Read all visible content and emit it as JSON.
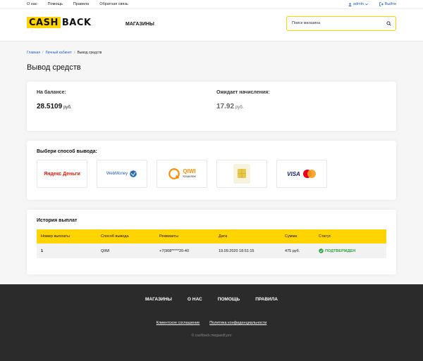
{
  "topbar": {
    "links": [
      "О нас",
      "Помощь",
      "Правила",
      "Обратная связь"
    ],
    "user": "admin",
    "logout": "Выйти"
  },
  "header": {
    "logo_cash": "CASH",
    "logo_back": "BACK",
    "nav_stores": "МАГАЗИНЫ",
    "search_placeholder": "Поиск магазина"
  },
  "breadcrumb": {
    "home": "Главная",
    "cabinet": "Личный кабинет",
    "current": "Вывод средств"
  },
  "page": {
    "title": "Вывод средств"
  },
  "balance": {
    "label": "На балансе:",
    "value": "28.5109",
    "unit": "руб.",
    "pending_label": "Ожидает начисления:",
    "pending_value": "17.92",
    "pending_unit": "руб."
  },
  "methods": {
    "title": "Выбери способ вывода:",
    "items": {
      "yandex": "Яндекс Деньги",
      "webmoney": "WebMoney",
      "qiwi": "QIWI",
      "qiwi_sub": "Кошелек",
      "visa": "VISA"
    }
  },
  "history": {
    "title": "История выплат",
    "columns": [
      "Номер выплаты",
      "Способ вывода",
      "Реквизиты",
      "Дата",
      "Сумма",
      "Статус"
    ],
    "rows": [
      [
        "1",
        "QIWI",
        "+7(908*****20-40",
        "19.09.2020 18:51:15",
        "475 руб.",
        "ПОДТВЕРЖДЕН"
      ]
    ]
  },
  "footer": {
    "nav": [
      "МАГАЗИНЫ",
      "О НАС",
      "ПОМОЩЬ",
      "ПРАВИЛА"
    ],
    "links": [
      "Клиентское соглашение",
      "Политика конфиденциальности"
    ],
    "copyright": "© cashback.megasoft.pro"
  },
  "colors": {
    "accent": "#ffd400",
    "link": "#1e5fbf",
    "success": "#2e9e3e",
    "footer": "#2b2b2b"
  }
}
